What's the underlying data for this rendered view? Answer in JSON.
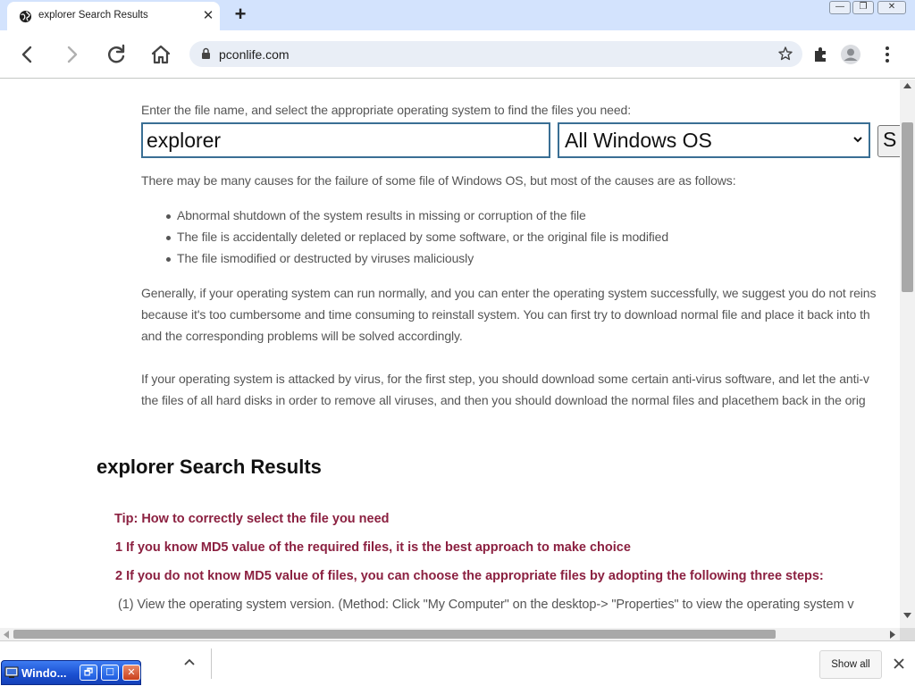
{
  "tab": {
    "title": "explorer Search Results",
    "close_glyph": "✕"
  },
  "new_tab_glyph": "+",
  "window_controls": {
    "minimize": "—",
    "maximize": "❐",
    "close": "✕"
  },
  "address_bar": {
    "url": "pconlife.com"
  },
  "page": {
    "intro": "Enter the file name, and select the appropriate operating system to find the files you need:",
    "search": {
      "value": "explorer",
      "os_selected": "All Windows OS",
      "button_label": "S"
    },
    "causes_intro": "There may be many causes for the failure of some file of Windows OS, but most of the causes are as follows:",
    "causes": [
      "Abnormal shutdown of the system results in missing or corruption of the file",
      "The file is accidentally deleted or replaced by some software, or the original file is modified",
      "The file ismodified or destructed by viruses maliciously"
    ],
    "para1": [
      "Generally, if your operating system can run normally, and you can enter the operating system successfully, we suggest you do not reins",
      "because it's too cumbersome and time consuming to reinstall system. You can first try to download normal file and place it back into th",
      "and the corresponding problems will be solved accordingly."
    ],
    "para2": [
      "If your operating system is attacked by virus, for the first step, you should download some certain anti-virus software, and let the anti-v",
      "the files of all hard disks in order to remove all viruses, and then you should download the normal files and placethem back in the orig"
    ],
    "results_heading": "explorer Search Results",
    "tips": [
      "Tip: How to correctly select the file you need",
      "1 If you know MD5 value of the required files, it is the best approach to make choice",
      "2 If you do not know MD5 value of files, you can choose the appropriate files by adopting the following three steps:"
    ],
    "step1": "(1) View the operating system version. (Method: Click \"My Computer\" on the desktop-> \"Properties\" to view the operating system v"
  },
  "download_bar": {
    "show_all": "Show all"
  },
  "minimized_window": {
    "title": "Windo...",
    "restore": "🗗",
    "maximize": "☐",
    "close": "✕"
  },
  "colors": {
    "tabstrip": "#d3e3fd",
    "omnibox": "#e9eef6",
    "body_text": "#555555",
    "tip_text": "#8b2040",
    "input_border": "#3a6f94"
  }
}
